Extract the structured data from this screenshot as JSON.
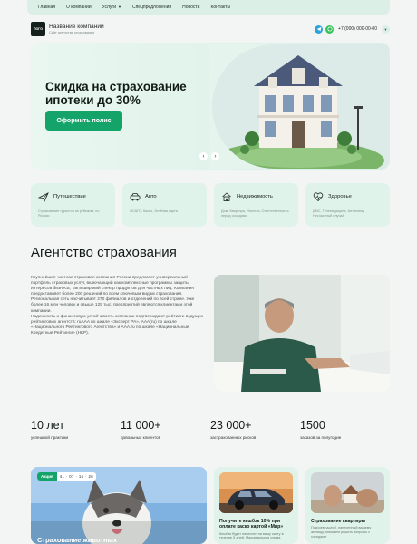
{
  "nav": {
    "items": [
      {
        "label": "Главная"
      },
      {
        "label": "О компании"
      },
      {
        "label": "Услуги",
        "has_dropdown": true
      },
      {
        "label": "Спецпредложения"
      },
      {
        "label": "Новости"
      },
      {
        "label": "Контакты"
      }
    ]
  },
  "header": {
    "logo_text": "ЛОГО",
    "company_name": "Название компании",
    "company_sub": "Сайт агентства страхования",
    "phone": "+7 (000) 000-00-00",
    "icons": [
      "telegram-icon",
      "whatsapp-icon",
      "chevron-down-icon"
    ]
  },
  "hero": {
    "title": "Скидка на страхование ипотеки до 30%",
    "button": "Оформить полис",
    "prev": "‹",
    "next": "›"
  },
  "categories": [
    {
      "title": "Путешествие",
      "desc": "Страхование туристов за рубежом, по России",
      "icon": "plane-icon"
    },
    {
      "title": "Авто",
      "desc": "ОСАГО, Каско, Зелёная карта",
      "icon": "car-icon"
    },
    {
      "title": "Недвижимость",
      "desc": "Дом, Квартира, Ипотека, Ответственность перед соседями",
      "icon": "house-icon"
    },
    {
      "title": "Здоровье",
      "desc": "ДМС, Телемедицина, Антиклещ, Несчастный случай",
      "icon": "heart-pulse-icon"
    }
  ],
  "about": {
    "title": "Агентство страхования",
    "paragraph1": "Крупнейшая частная страховая компания России предлагает универсальный портфель страховых услуг, включающий как комплексные программы защиты интересов бизнеса, так и широкий спектр продуктов для частных лиц. Компания предоставляет более 200 решений по всем ключевым видам страхования. Региональная сеть насчитывает 270 филиалов и отделений по всей стране. Уже более 16 млн человек и свыше 125 тыс. предприятий являются клиентами этой компании.",
    "paragraph2": "Надежность и финансовую устойчивость компании подтверждают рейтинги ведущих рейтинговых агентств: ruAAA по шкале «Эксперт РА», AAA(ru) по шкале «Национального Рейтингового Агентства» и AAA.ru по шкале «Национальные Кредитные Рейтинги» (НКР)."
  },
  "stats": [
    {
      "value": "10 лет",
      "label": "успешной практики"
    },
    {
      "value": "11 000+",
      "label": "довольных клиентов"
    },
    {
      "value": "23 000+",
      "label": "застрахованных рисков"
    },
    {
      "value": "1500",
      "label": "заказов за полугодие"
    }
  ],
  "promos": {
    "main": {
      "badge": "Акция",
      "timer": "41 · 07 · 16 · 26",
      "caption": "Страхование животных"
    },
    "card1": {
      "title": "Получите кешбэк 10% при оплате каско картой «Мир»",
      "desc": "Кешбэк будет начислен на вашу карту в течение 5 дней. Максимальная сумма"
    },
    "card2": {
      "title": "Страхование квартиры",
      "desc": "Покроем ущерб, нанесенный вашему жилищу, поможем решить вопросы с соседями"
    }
  },
  "colors": {
    "accent": "#14a46a",
    "nav_bg": "#dcefe7",
    "card_bg": "#dff3ea",
    "page_bg": "#f3f5f4"
  }
}
